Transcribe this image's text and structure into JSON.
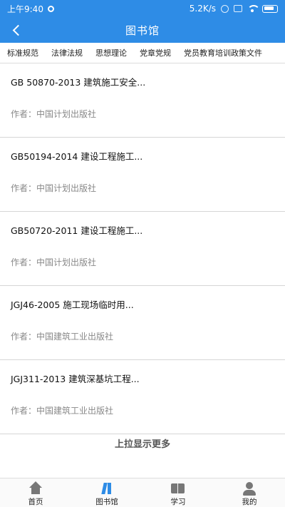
{
  "status": {
    "time": "上午9:40",
    "speed": "5.2K/s"
  },
  "header": {
    "title": "图书馆"
  },
  "categories": [
    "标准规范",
    "法律法规",
    "思想理论",
    "党章党规",
    "党员教育培训政策文件"
  ],
  "books": [
    {
      "name": "GB 50870-2013 建筑施工安全...",
      "author": "作者：中国计划出版社"
    },
    {
      "name": "GB50194-2014 建设工程施工...",
      "author": "作者：中国计划出版社"
    },
    {
      "name": "GB50720-2011 建设工程施工...",
      "author": "作者：中国计划出版社"
    },
    {
      "name": "JGJ46-2005 施工现场临时用...",
      "author": "作者：中国建筑工业出版社"
    },
    {
      "name": "JGJ311-2013 建筑深基坑工程...",
      "author": "作者：中国建筑工业出版社"
    }
  ],
  "load_more": "上拉显示更多",
  "tabs": [
    {
      "label": "首页",
      "icon": "home-icon"
    },
    {
      "label": "图书馆",
      "icon": "library-icon"
    },
    {
      "label": "学习",
      "icon": "book-icon"
    },
    {
      "label": "我的",
      "icon": "user-icon"
    }
  ],
  "colors": {
    "primary": "#2e8ce6",
    "secondary_text": "#888888"
  }
}
